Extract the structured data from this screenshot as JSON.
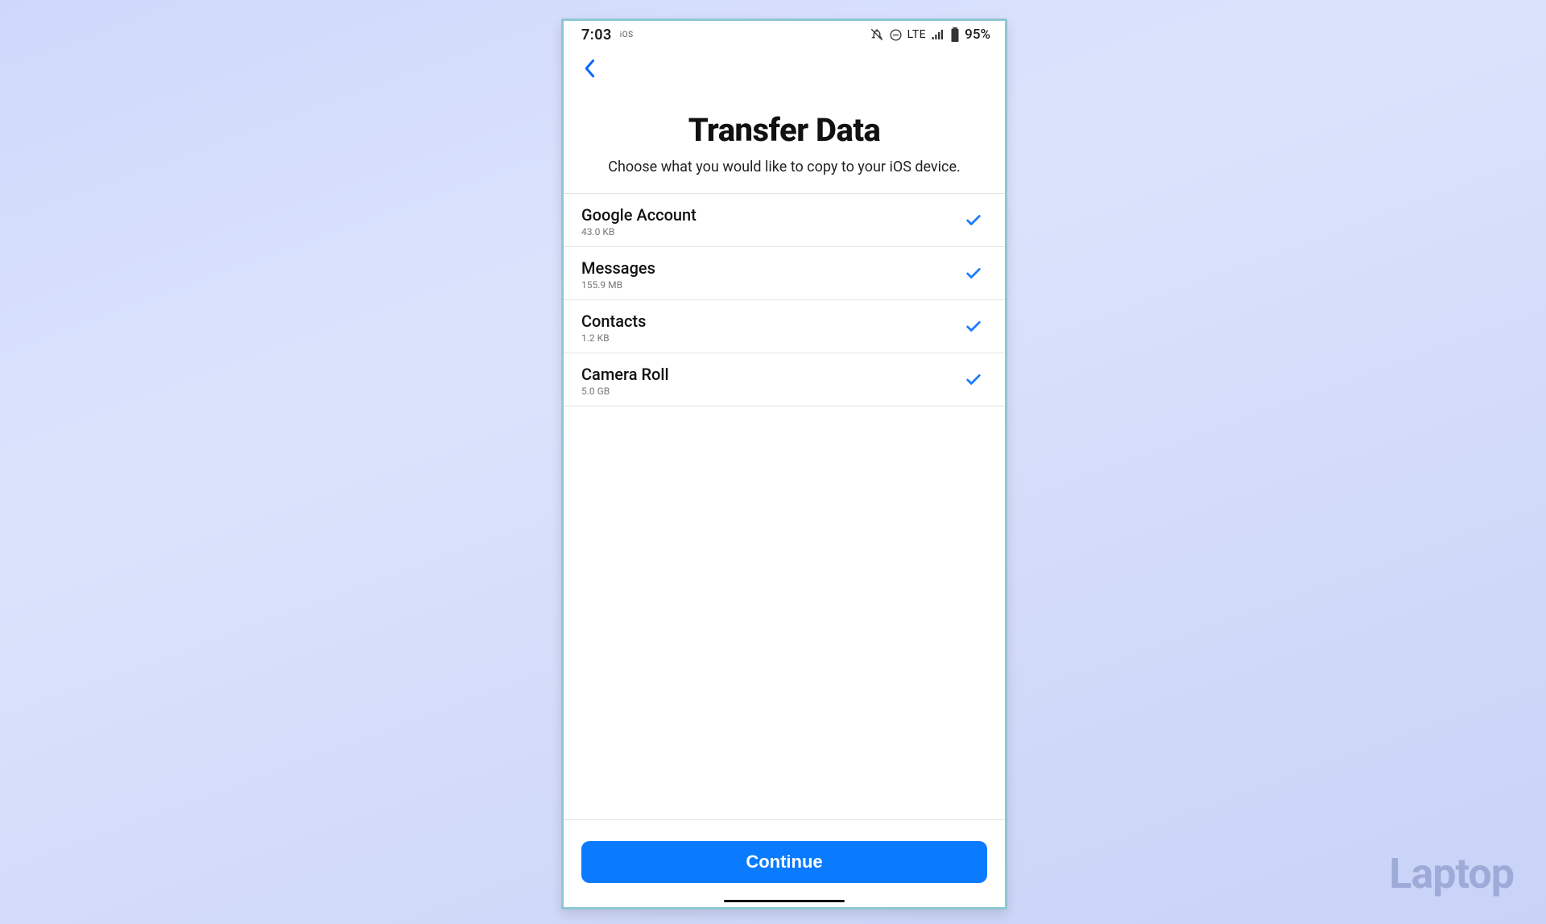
{
  "status": {
    "time": "7:03",
    "sub": "iOS",
    "lte": "LTE",
    "battery": "95%"
  },
  "page": {
    "title": "Transfer Data",
    "subtitle": "Choose what you would like to copy to your iOS device."
  },
  "items": [
    {
      "label": "Google Account",
      "size": "43.0 KB",
      "checked": true
    },
    {
      "label": "Messages",
      "size": "155.9 MB",
      "checked": true
    },
    {
      "label": "Contacts",
      "size": "1.2 KB",
      "checked": true
    },
    {
      "label": "Camera Roll",
      "size": "5.0 GB",
      "checked": true
    }
  ],
  "footer": {
    "continue": "Continue"
  },
  "watermark": "Laptop"
}
